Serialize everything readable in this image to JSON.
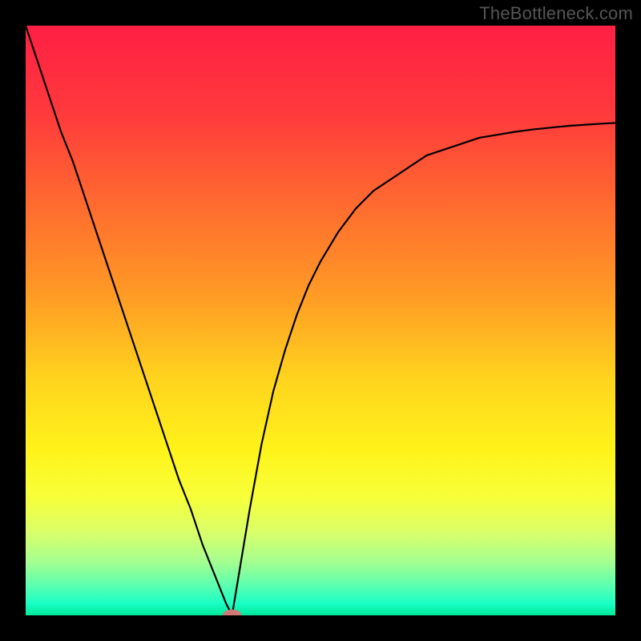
{
  "watermark": "TheBottleneck.com",
  "chart_data": {
    "type": "line",
    "title": "",
    "xlabel": "",
    "ylabel": "",
    "xlim": [
      0,
      1
    ],
    "ylim": [
      0,
      1
    ],
    "grid": false,
    "legend": false,
    "background": {
      "type": "vertical-gradient",
      "stops": [
        {
          "offset": 0.0,
          "color": "#ff1f43"
        },
        {
          "offset": 0.15,
          "color": "#ff3a3c"
        },
        {
          "offset": 0.3,
          "color": "#ff6a2f"
        },
        {
          "offset": 0.45,
          "color": "#ff9825"
        },
        {
          "offset": 0.6,
          "color": "#ffd41e"
        },
        {
          "offset": 0.72,
          "color": "#fff31a"
        },
        {
          "offset": 0.8,
          "color": "#f7ff3a"
        },
        {
          "offset": 0.86,
          "color": "#d9ff6a"
        },
        {
          "offset": 0.91,
          "color": "#a3ff90"
        },
        {
          "offset": 0.95,
          "color": "#5affb0"
        },
        {
          "offset": 0.98,
          "color": "#1affc4"
        },
        {
          "offset": 1.0,
          "color": "#00e89a"
        }
      ]
    },
    "series": [
      {
        "name": "bottleneck-curve",
        "color": "#000000",
        "x": [
          0.0,
          0.02,
          0.04,
          0.06,
          0.08,
          0.1,
          0.12,
          0.14,
          0.16,
          0.18,
          0.2,
          0.22,
          0.24,
          0.26,
          0.28,
          0.3,
          0.32,
          0.34,
          0.35,
          0.36,
          0.38,
          0.4,
          0.42,
          0.44,
          0.46,
          0.48,
          0.5,
          0.53,
          0.56,
          0.59,
          0.62,
          0.65,
          0.68,
          0.71,
          0.74,
          0.77,
          0.8,
          0.83,
          0.86,
          0.89,
          0.92,
          0.95,
          0.98,
          1.0
        ],
        "y": [
          1.0,
          0.94,
          0.88,
          0.82,
          0.77,
          0.71,
          0.65,
          0.59,
          0.53,
          0.47,
          0.41,
          0.35,
          0.29,
          0.23,
          0.18,
          0.12,
          0.07,
          0.02,
          0.0,
          0.06,
          0.18,
          0.29,
          0.38,
          0.45,
          0.51,
          0.56,
          0.6,
          0.65,
          0.69,
          0.72,
          0.74,
          0.76,
          0.78,
          0.79,
          0.8,
          0.81,
          0.815,
          0.82,
          0.824,
          0.827,
          0.83,
          0.832,
          0.834,
          0.835
        ]
      }
    ],
    "marker": {
      "name": "min-point",
      "x": 0.35,
      "y": 0.0,
      "rx": 0.016,
      "ry": 0.01,
      "color": "#d07a78"
    }
  }
}
